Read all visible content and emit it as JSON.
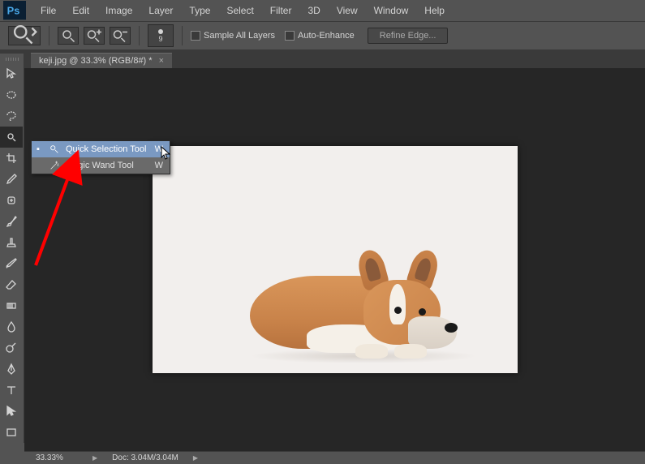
{
  "app": {
    "logo_text": "Ps"
  },
  "menu": {
    "items": [
      "File",
      "Edit",
      "Image",
      "Layer",
      "Type",
      "Select",
      "Filter",
      "3D",
      "View",
      "Window",
      "Help"
    ]
  },
  "options": {
    "brush_size": "9",
    "sample_all_layers": "Sample All Layers",
    "auto_enhance": "Auto-Enhance",
    "refine_edge": "Refine Edge..."
  },
  "tab": {
    "title": "keji.jpg @ 33.3% (RGB/8#) *",
    "close": "×"
  },
  "flyout": {
    "items": [
      {
        "label": "Quick Selection Tool",
        "shortcut": "W",
        "selected": true
      },
      {
        "label": "Magic Wand Tool",
        "shortcut": "W",
        "selected": false
      }
    ],
    "check_glyph": "▪"
  },
  "status": {
    "zoom": "33.33%",
    "doc": "Doc: 3.04M/3.04M",
    "tri": "▶"
  }
}
